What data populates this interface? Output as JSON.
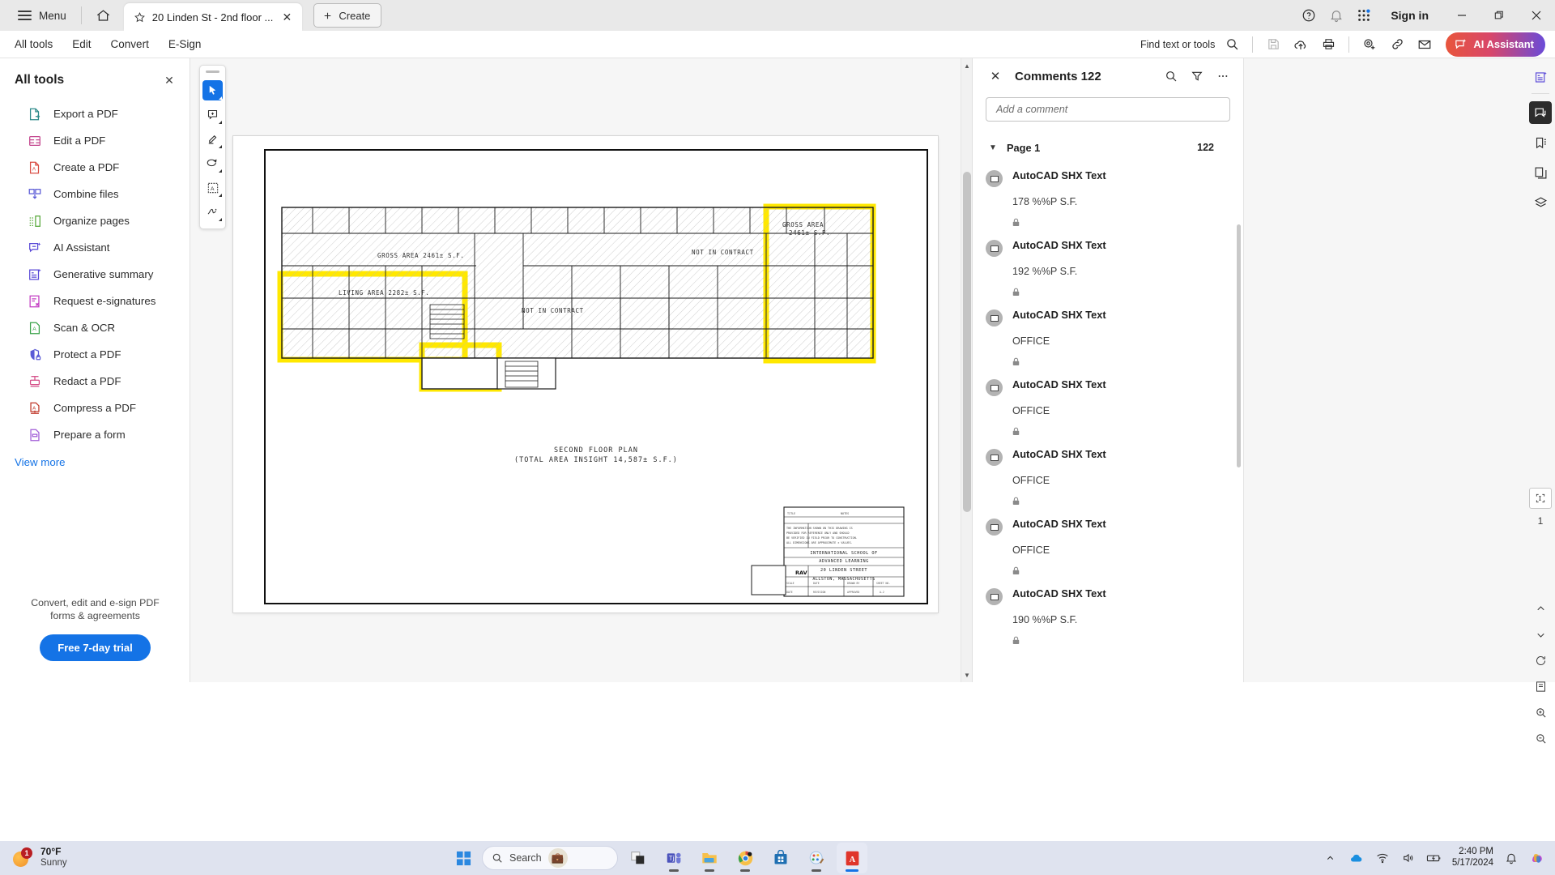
{
  "titlebar": {
    "menu_label": "Menu",
    "home_icon": "home-icon",
    "tab": {
      "star_icon": "star-icon",
      "title": "20 Linden St - 2nd floor ...",
      "close_icon": "close-icon"
    },
    "create_label": "Create",
    "help_icon": "help-circle-icon",
    "bell_icon": "bell-icon",
    "apps_icon": "app-grid-icon",
    "signin_label": "Sign in",
    "minimize_icon": "minimize-icon",
    "restore_icon": "restore-icon",
    "close_icon": "window-close-icon"
  },
  "menubar": {
    "items": [
      {
        "label": "All tools",
        "active": true
      },
      {
        "label": "Edit",
        "active": false
      },
      {
        "label": "Convert",
        "active": false
      },
      {
        "label": "E-Sign",
        "active": false
      }
    ],
    "find_label": "Find text or tools",
    "icons": [
      "search-icon",
      "save-icon",
      "upload-cloud-icon",
      "print-icon",
      "add-person-icon",
      "link-icon",
      "email-icon"
    ],
    "ai_label": "AI Assistant"
  },
  "sidebar": {
    "title": "All tools",
    "close_icon": "close-icon",
    "items": [
      {
        "label": "Export a PDF",
        "icon": "export-pdf-icon",
        "color": "#2d8a8a"
      },
      {
        "label": "Edit a PDF",
        "icon": "edit-pdf-icon",
        "color": "#c4478f"
      },
      {
        "label": "Create a PDF",
        "icon": "create-pdf-icon",
        "color": "#d94c43"
      },
      {
        "label": "Combine files",
        "icon": "combine-files-icon",
        "color": "#5b5bd6"
      },
      {
        "label": "Organize pages",
        "icon": "organize-pages-icon",
        "color": "#57a83a"
      },
      {
        "label": "AI Assistant",
        "icon": "ai-assistant-icon",
        "color": "#5b4bd8"
      },
      {
        "label": "Generative summary",
        "icon": "generative-summary-icon",
        "color": "#5b4bd8"
      },
      {
        "label": "Request e-signatures",
        "icon": "request-esign-icon",
        "color": "#c43fc4"
      },
      {
        "label": "Scan & OCR",
        "icon": "scan-ocr-icon",
        "color": "#3aa34a"
      },
      {
        "label": "Protect a PDF",
        "icon": "protect-pdf-icon",
        "color": "#5b5bd6"
      },
      {
        "label": "Redact a PDF",
        "icon": "redact-pdf-icon",
        "color": "#d44b86"
      },
      {
        "label": "Compress a PDF",
        "icon": "compress-pdf-icon",
        "color": "#c0392b"
      },
      {
        "label": "Prepare a form",
        "icon": "prepare-form-icon",
        "color": "#a05bd6"
      }
    ],
    "view_more": "View more",
    "promo_text": "Convert, edit and e-sign PDF forms & agreements",
    "trial_label": "Free 7-day trial"
  },
  "viewer_toolbar": {
    "tools": [
      {
        "name": "select-cursor-tool",
        "active": true
      },
      {
        "name": "add-comment-tool",
        "active": false
      },
      {
        "name": "highlighter-tool",
        "active": false
      },
      {
        "name": "draw-lasso-tool",
        "active": false
      },
      {
        "name": "text-select-tool",
        "active": false
      },
      {
        "name": "signature-tool",
        "active": false
      }
    ]
  },
  "document": {
    "plan_title_line1": "SECOND FLOOR PLAN",
    "plan_title_line2": "(TOTAL AREA INSIGHT 14,587± S.F.)",
    "labels": {
      "gross_area_1": "GROSS AREA 2461± S.F.",
      "gross_area_2": "GROSS AREA 2461± S.F.",
      "living_area": "LIVING AREA 2282± S.F.",
      "not_in_contract_1": "NOT IN CONTRACT",
      "not_in_contract_2": "NOT IN CONTRACT"
    },
    "title_block": {
      "line1": "INTERNATIONAL SCHOOL OF",
      "line2": "ADVANCED LEARNING",
      "line3": "20 LINDEN STREET",
      "line4": "ALLSTON, MASSACHUSETTS",
      "firm": "RAV"
    }
  },
  "comments": {
    "close_icon": "close-icon",
    "title": "Comments 122",
    "search_icon": "search-icon",
    "filter_icon": "filter-icon",
    "more_icon": "more-options-icon",
    "input_placeholder": "Add a comment",
    "page_group": {
      "label": "Page 1",
      "count": "122",
      "chevron": "chevron-down-icon"
    },
    "items": [
      {
        "author": "AutoCAD SHX Text",
        "text": "178 %%P S.F.",
        "lock": "lock-icon"
      },
      {
        "author": "AutoCAD SHX Text",
        "text": "192 %%P S.F.",
        "lock": "lock-icon"
      },
      {
        "author": "AutoCAD SHX Text",
        "text": "OFFICE",
        "lock": "lock-icon"
      },
      {
        "author": "AutoCAD SHX Text",
        "text": "OFFICE",
        "lock": "lock-icon"
      },
      {
        "author": "AutoCAD SHX Text",
        "text": "OFFICE",
        "lock": "lock-icon"
      },
      {
        "author": "AutoCAD SHX Text",
        "text": "OFFICE",
        "lock": "lock-icon"
      },
      {
        "author": "AutoCAD SHX Text",
        "text": "190 %%P S.F.",
        "lock": "lock-icon"
      }
    ]
  },
  "rail": {
    "buttons": [
      {
        "name": "generative-summary-rail-icon",
        "selected": false
      },
      {
        "name": "comments-rail-icon",
        "selected": true
      },
      {
        "name": "bookmarks-rail-icon",
        "selected": false
      },
      {
        "name": "page-thumbnails-rail-icon",
        "selected": false
      },
      {
        "name": "layers-rail-icon",
        "selected": false
      }
    ],
    "page_indicator": "1",
    "bottom_buttons": [
      {
        "name": "scroll-up-icon"
      },
      {
        "name": "scroll-down-icon"
      },
      {
        "name": "rotate-icon"
      },
      {
        "name": "fit-page-icon"
      },
      {
        "name": "zoom-in-icon"
      },
      {
        "name": "zoom-out-icon"
      }
    ]
  },
  "taskbar": {
    "weather": {
      "temp": "70°F",
      "condition": "Sunny",
      "badge": "1"
    },
    "start_icon": "windows-start-icon",
    "search_placeholder": "Search",
    "apps": [
      "task-view-icon",
      "teams-icon",
      "file-explorer-icon",
      "chrome-icon",
      "store-icon",
      "paint-icon",
      "acrobat-icon"
    ],
    "tray": {
      "chevron_icon": "show-hidden-icons-icon",
      "onedrive_icon": "onedrive-icon",
      "wifi_icon": "wifi-icon",
      "volume_icon": "volume-icon",
      "battery_icon": "battery-icon",
      "time": "2:40 PM",
      "date": "5/17/2024",
      "notification_icon": "notification-bell-icon",
      "copilot_icon": "copilot-icon"
    }
  },
  "colors": {
    "accent_blue": "#1473e6",
    "highlight_yellow": "#ffe800",
    "taskbar": "#dfe3ef"
  }
}
